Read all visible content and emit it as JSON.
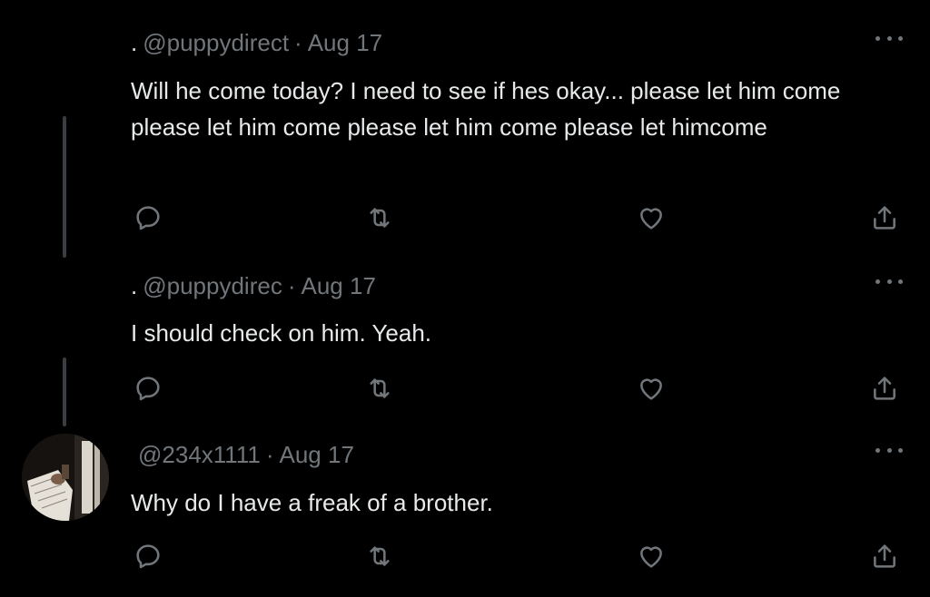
{
  "tweets": [
    {
      "prefix": ".",
      "handle": "@puppydirect",
      "separator": "·",
      "date": "Aug 17",
      "text": "Will he come today? I need to see if hes okay... please let him come please let him come please let him come please let himcome",
      "more_icon": "more-horizontal-icon"
    },
    {
      "prefix": ".",
      "handle": "@puppydirec",
      "separator": "·",
      "date": "Aug 17",
      "text": "I should check on him. Yeah.",
      "more_icon": "more-horizontal-icon"
    },
    {
      "prefix": "",
      "handle": "@234x1111",
      "separator": "·",
      "date": "Aug 17",
      "text": "Why do I have a freak of a brother.",
      "more_icon": "more-horizontal-icon"
    }
  ],
  "action_icons": [
    "reply-icon",
    "retweet-icon",
    "like-icon",
    "share-icon"
  ],
  "colors": {
    "background": "#000000",
    "text": "#e7e9ea",
    "muted": "#71767b",
    "thread_line": "#3a3d41"
  }
}
